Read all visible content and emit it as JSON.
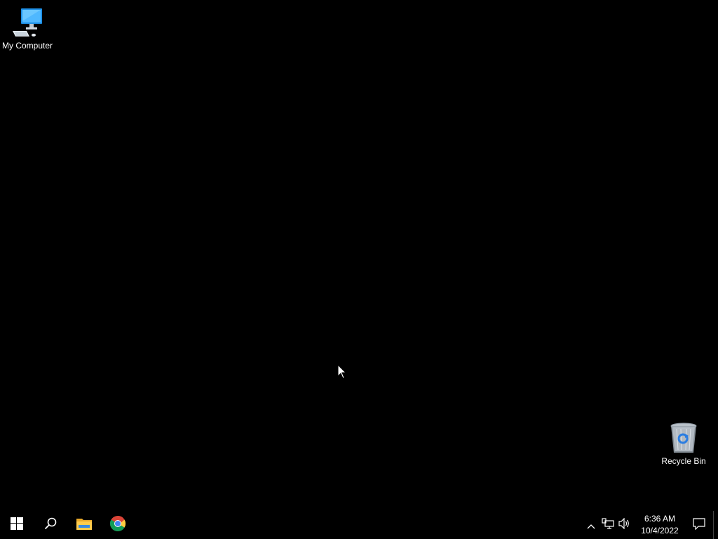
{
  "desktop": {
    "background_color": "#000000",
    "icons": [
      {
        "label": "My Computer",
        "icon": "computer-icon"
      },
      {
        "label": "Recycle Bin",
        "icon": "recycle-bin-icon"
      }
    ]
  },
  "taskbar": {
    "background_color": "#000000",
    "pinned": [
      {
        "name": "Start",
        "icon": "windows-logo-icon"
      },
      {
        "name": "Search",
        "icon": "search-icon"
      },
      {
        "name": "File Explorer",
        "icon": "folder-icon"
      },
      {
        "name": "Google Chrome",
        "icon": "chrome-icon"
      }
    ],
    "tray": {
      "icons": [
        "chevron-up-icon",
        "network-icon",
        "volume-icon"
      ],
      "time": "6:36 AM",
      "date": "10/4/2022",
      "notification_icon": "notification-icon"
    }
  }
}
